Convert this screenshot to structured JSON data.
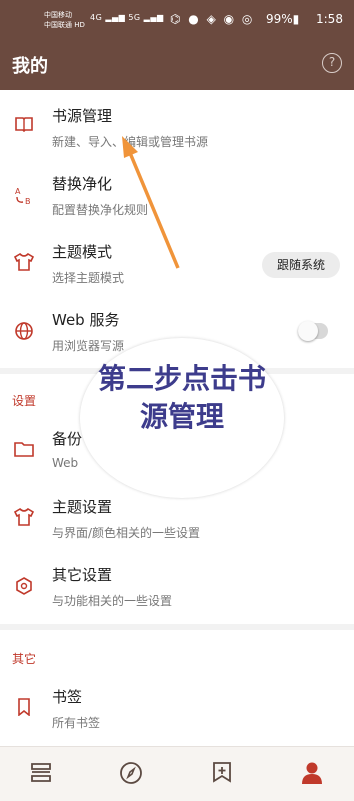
{
  "status_bar": {
    "carrier1": "中国移动",
    "carrier2": "中国联通 HD",
    "signal": "4G ▂▄▆ 5G ▂▄▆",
    "icons": "⌬ ● ◈ ◉ ◎",
    "battery": "99%▮",
    "time": "1:58"
  },
  "app_bar": {
    "title": "我的",
    "help_icon": "?"
  },
  "items": {
    "source": {
      "title": "书源管理",
      "sub": "新建、导入、编辑或管理书源"
    },
    "replace": {
      "title": "替换净化",
      "sub": "配置替换净化规则"
    },
    "theme_mode": {
      "title": "主题模式",
      "sub": "选择主题模式",
      "chip": "跟随系统"
    },
    "web": {
      "title": "Web 服务",
      "sub": "用浏览器写源",
      "toggle_on": false
    },
    "backup": {
      "title": "备份",
      "sub": "Web"
    },
    "theme_settings": {
      "title": "主题设置",
      "sub": "与界面/颜色相关的一些设置"
    },
    "other_settings": {
      "title": "其它设置",
      "sub": "与功能相关的一些设置"
    },
    "bookmarks": {
      "title": "书签",
      "sub": "所有书签"
    }
  },
  "sections": {
    "settings": "设置",
    "other": "其它"
  },
  "tutorial": {
    "bubble_text": "第二步点击书源管理",
    "arrow_color": "#f0943a"
  },
  "colors": {
    "brand": "#6b4a3f",
    "accent": "#c0392b",
    "tutorial_text": "#3d3c8c"
  },
  "bottom_nav": {
    "bookshelf_icon": "☰",
    "discover_icon": "◈",
    "rss_icon": "⊞",
    "profile_icon": "●"
  }
}
